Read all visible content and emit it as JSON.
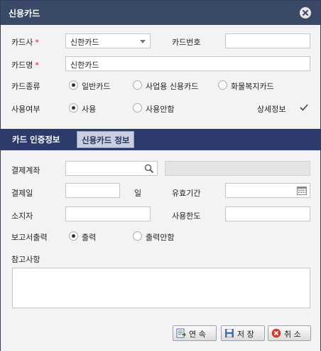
{
  "window": {
    "title": "신용카드"
  },
  "fields": {
    "card_company": {
      "label": "카드사",
      "value": "신한카드"
    },
    "card_number": {
      "label": "카드번호",
      "value": ""
    },
    "card_name": {
      "label": "카드명",
      "value": "신한카드"
    },
    "card_type": {
      "label": "카드종류",
      "options": [
        "일반카드",
        "사업용 신용카드",
        "화물복지카드"
      ],
      "selected": 0
    },
    "usage": {
      "label": "사용여부",
      "options": [
        "사용",
        "사용안함"
      ],
      "selected": 0
    },
    "details": {
      "label": "상세정보",
      "checked": true
    }
  },
  "tabs": [
    {
      "label": "카드 인증정보",
      "active": false
    },
    {
      "label": "신용카드 정보",
      "active": true
    }
  ],
  "panel": {
    "payment_account": {
      "label": "결제계좌",
      "value": ""
    },
    "payment_day": {
      "label": "결제일",
      "value": "",
      "suffix": "일"
    },
    "expiry": {
      "label": "유효기간",
      "value": ""
    },
    "holder": {
      "label": "소지자",
      "value": ""
    },
    "limit": {
      "label": "사용한도",
      "value": ""
    },
    "report_output": {
      "label": "보고서출력",
      "options": [
        "출력",
        "출력안함"
      ],
      "selected": 0
    },
    "notes": {
      "label": "참고사항",
      "value": ""
    }
  },
  "buttons": {
    "continue": "연 속",
    "save": "저 장",
    "cancel": "취 소"
  },
  "icons": {
    "close": "close-icon",
    "search": "search-icon",
    "calendar": "calendar-icon",
    "continue": "continue-icon",
    "save": "save-icon",
    "cancel": "cancel-icon"
  },
  "colors": {
    "titlebar": "#3b4968",
    "tabbar": "#2c3b6b",
    "required": "#e02020"
  }
}
